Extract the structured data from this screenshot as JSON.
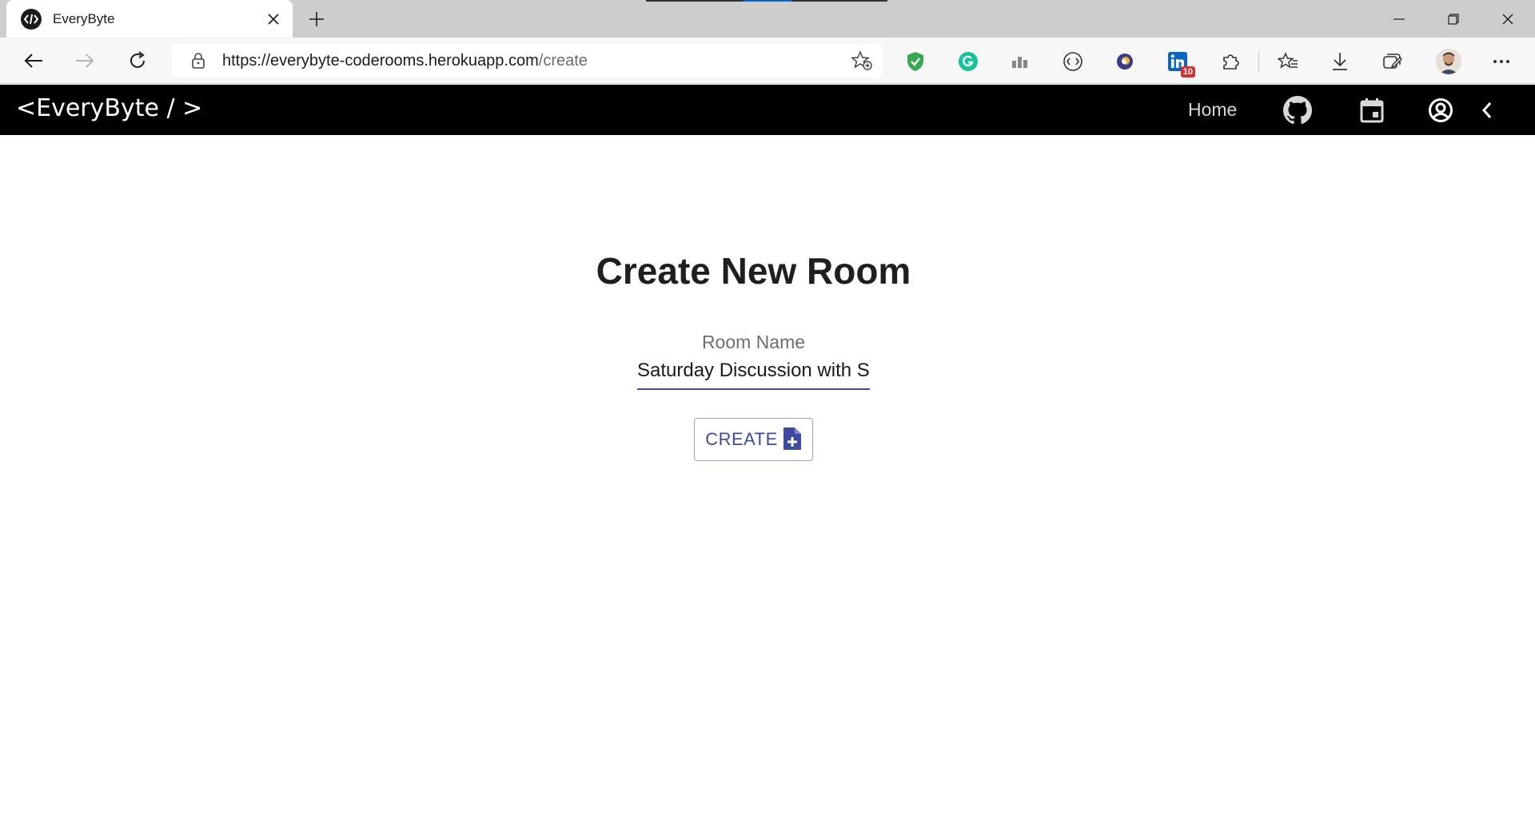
{
  "browser": {
    "tab_title": "EveryByte",
    "url_main": "https://everybyte-coderooms.herokuapp.com",
    "url_path": "/create",
    "linkedin_badge": "10"
  },
  "app": {
    "brand": "<EveryByte / >",
    "nav_home": "Home"
  },
  "page": {
    "heading": "Create New Room",
    "room_name_label": "Room Name",
    "room_name_value": "Saturday Discussion with S",
    "create_button": "CREATE"
  },
  "colors": {
    "accent": "#3f4ba0",
    "appbar": "#000000"
  }
}
